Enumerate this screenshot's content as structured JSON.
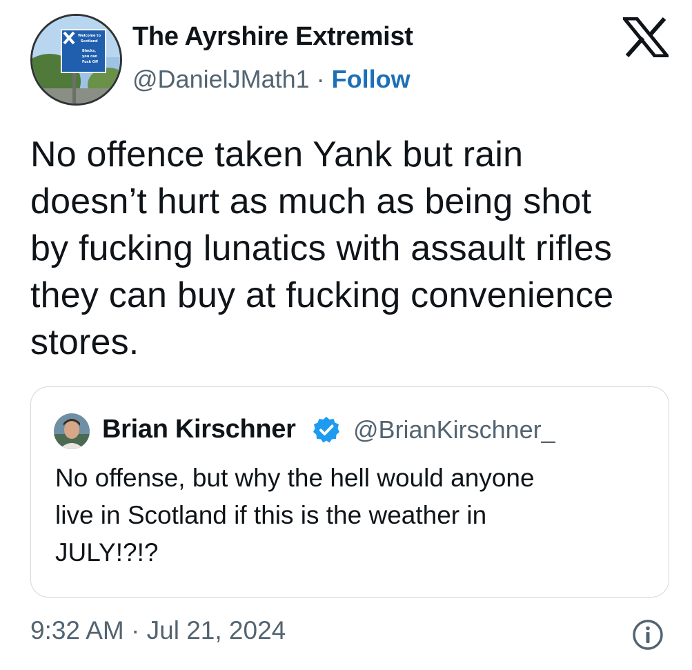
{
  "author": {
    "name": "The Ayrshire Extremist",
    "handle": "@DanielJMath1",
    "separator": " · ",
    "follow_label": "Follow",
    "avatar_sign_text": [
      "Welcome to",
      "Scotland",
      "Blacks,",
      "you can",
      "Fuck Off"
    ]
  },
  "brand": {
    "icon": "x-logo-icon"
  },
  "tweet": {
    "text": "No offence taken Yank but rain\ndoesn’t hurt as much as being shot\nby fucking lunatics with assault rifles\nthey can buy at fucking convenience\nstores."
  },
  "quoted_tweet": {
    "name": "Brian Kirschner",
    "verified": true,
    "handle": "@BrianKirschner_",
    "text": "No offense, but why the hell would anyone\nlive in Scotland if this is the weather in\nJULY!?!?"
  },
  "footer": {
    "timestamp": "9:32 AM · Jul 21, 2024",
    "info_icon": "info-icon"
  },
  "colors": {
    "text": "#0f1419",
    "secondary": "#536471",
    "follow": "#1d70b8",
    "verified": "#1d9bf0",
    "border": "#cfd9de"
  }
}
